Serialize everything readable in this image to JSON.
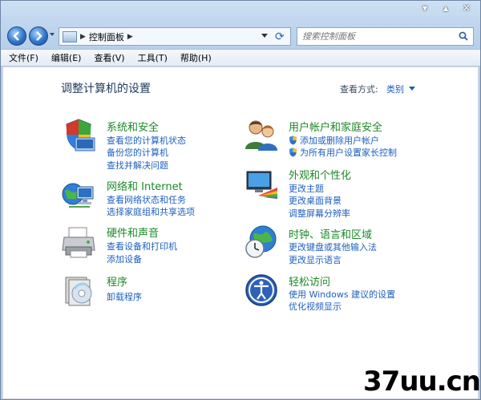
{
  "window": {
    "caption": {
      "minimize": "▾",
      "maximize": "▴",
      "close": "✕"
    }
  },
  "address_bar": {
    "path": "控制面板",
    "search_placeholder": "搜索控制面板"
  },
  "menu": [
    "文件(F)",
    "编辑(E)",
    "查看(V)",
    "工具(T)",
    "帮助(H)"
  ],
  "content": {
    "title": "调整计算机的设置",
    "view_by_label": "查看方式:",
    "view_by_value": "类别"
  },
  "categories": [
    {
      "title": "系统和安全",
      "icon": "shield-icon",
      "links": [
        "查看您的计算机状态",
        "备份您的计算机",
        "查找并解决问题"
      ]
    },
    {
      "title": "网络和 Internet",
      "icon": "network-icon",
      "links": [
        "查看网络状态和任务",
        "选择家庭组和共享选项"
      ]
    },
    {
      "title": "硬件和声音",
      "icon": "printer-icon",
      "links": [
        "查看设备和打印机",
        "添加设备"
      ]
    },
    {
      "title": "程序",
      "icon": "programs-icon",
      "links": [
        "卸载程序"
      ]
    },
    {
      "title": "用户帐户和家庭安全",
      "icon": "users-icon",
      "links": [
        "添加或删除用户帐户",
        "为所有用户设置家长控制"
      ]
    },
    {
      "title": "外观和个性化",
      "icon": "monitor-palette-icon",
      "links": [
        "更改主题",
        "更改桌面背景",
        "调整屏幕分辨率"
      ]
    },
    {
      "title": "时钟、语言和区域",
      "icon": "globe-clock-icon",
      "links": [
        "更改键盘或其他输入法",
        "更改显示语言"
      ]
    },
    {
      "title": "轻松访问",
      "icon": "accessibility-icon",
      "links": [
        "使用 Windows 建议的设置",
        "优化视频显示"
      ]
    }
  ],
  "colors": {
    "link": "#1d5fc1",
    "category_title": "#1c8826",
    "window_frame": "#bcd3ea"
  },
  "watermark": "37uu.cn"
}
